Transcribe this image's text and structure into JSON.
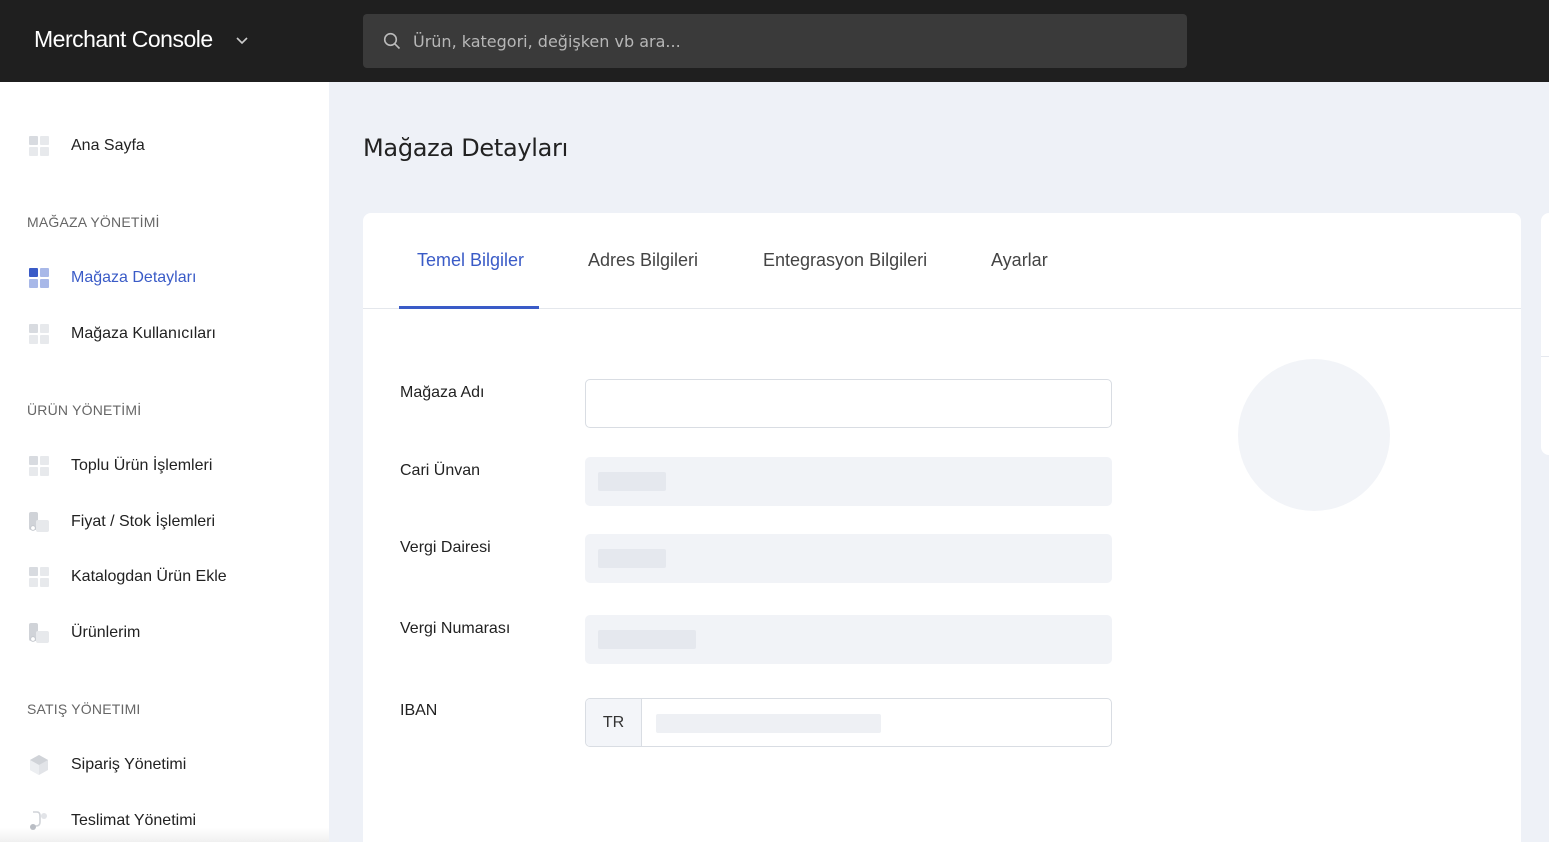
{
  "header": {
    "brand": "Merchant Console",
    "search_placeholder": "Ürün, kategori, değişken vb ara..."
  },
  "sidebar": {
    "home": "Ana Sayfa",
    "sections": [
      {
        "title": "MAĞAZA YÖNETİMİ",
        "items": [
          "Mağaza Detayları",
          "Mağaza Kullanıcıları"
        ]
      },
      {
        "title": "ÜRÜN YÖNETİMİ",
        "items": [
          "Toplu Ürün İşlemleri",
          "Fiyat / Stok İşlemleri",
          "Katalogdan Ürün Ekle",
          "Ürünlerim"
        ]
      },
      {
        "title": "SATIŞ YÖNETIMI",
        "items": [
          "Sipariş Yönetimi",
          "Teslimat Yönetimi"
        ]
      }
    ],
    "active_item": "Mağaza Detayları"
  },
  "page": {
    "title": "Mağaza Detayları"
  },
  "tabs": {
    "items": [
      "Temel Bilgiler",
      "Adres Bilgileri",
      "Entegrasyon Bilgileri",
      "Ayarlar"
    ],
    "active": "Temel Bilgiler"
  },
  "form": {
    "store_name_label": "Mağaza Adı",
    "store_name_value": "",
    "company_title_label": "Cari Ünvan",
    "tax_office_label": "Vergi Dairesi",
    "tax_number_label": "Vergi Numarası",
    "iban_label": "IBAN",
    "iban_prefix": "TR"
  },
  "colors": {
    "accent": "#3a5bc7",
    "topbar": "#1f1f1f",
    "background": "#eef1f7"
  }
}
